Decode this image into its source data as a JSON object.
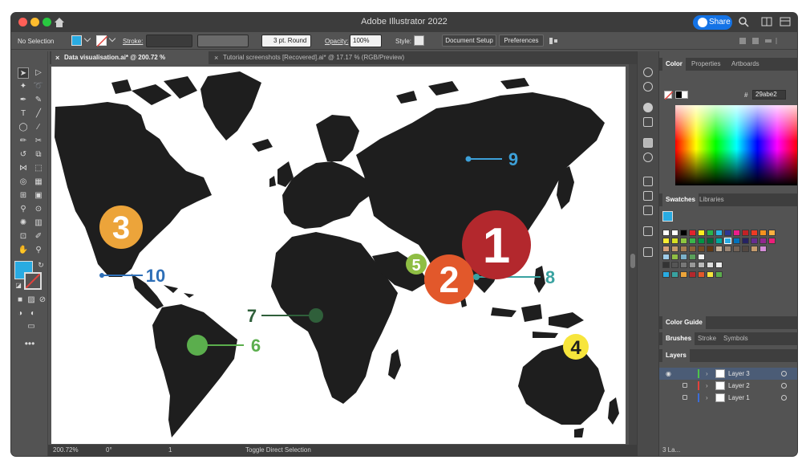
{
  "window": {
    "title": "Adobe Illustrator 2022",
    "share_label": "Share"
  },
  "controlbar": {
    "selection": "No Selection",
    "stroke_label": "Stroke:",
    "brush_value": "3 pt. Round",
    "opacity_label": "Opacity:",
    "opacity_value": "100%",
    "style_label": "Style:",
    "document_setup_label": "Document Setup",
    "preferences_label": "Preferences"
  },
  "tabs": [
    {
      "label": "Data visualisation.ai* @ 200.72 % (RGB/Preview)",
      "close": "×"
    },
    {
      "label": "Tutorial screenshots [Recovered].ai* @ 17.17 % (RGB/Preview)",
      "close": "×"
    }
  ],
  "map": {
    "land_color": "#1e1e1e",
    "markers": [
      {
        "id": "1",
        "label": "1",
        "color": "#b3282d",
        "callout": null
      },
      {
        "id": "2",
        "label": "2",
        "color": "#e2582b",
        "callout": null
      },
      {
        "id": "3",
        "label": "3",
        "color": "#eca43a",
        "callout": null
      },
      {
        "id": "4",
        "label": "4",
        "color": "#f7e53c",
        "callout": null
      },
      {
        "id": "5",
        "label": "5",
        "color": "#8fbe44",
        "callout": null
      },
      {
        "id": "6",
        "label": "6",
        "color": "#5bae4d",
        "callout": "6"
      },
      {
        "id": "7",
        "label": "7",
        "color": "#2f5f3a",
        "callout": "7"
      },
      {
        "id": "8",
        "label": "8",
        "color": "#39a2a0",
        "callout": "8"
      },
      {
        "id": "9",
        "label": "9",
        "color": "#3da0d8",
        "callout": "9"
      },
      {
        "id": "10",
        "label": "10",
        "color": "#2e6fb7",
        "callout": "10"
      }
    ]
  },
  "statusbar": {
    "zoom": "200.72%",
    "rotate": "0°",
    "artboard": "1",
    "status": "Toggle Direct Selection"
  },
  "panels": {
    "color_tabs": [
      "Color",
      "Properties",
      "Artboards"
    ],
    "hex_label": "#",
    "hex_value": "29abe2",
    "swatch_tabs": [
      "Swatches",
      "Libraries"
    ],
    "color_guide_label": "Color Guide",
    "lib_tabs": [
      "Brushes",
      "Stroke",
      "Symbols"
    ],
    "layers_tab": "Layers",
    "layers": [
      {
        "name": "Layer 3",
        "color": "#4fc34a",
        "selected": true,
        "locked": false
      },
      {
        "name": "Layer 2",
        "color": "#e3423c",
        "selected": false,
        "locked": true
      },
      {
        "name": "Layer 1",
        "color": "#3b6cd8",
        "selected": false,
        "locked": true
      }
    ],
    "layers_count": "3 La..."
  },
  "colors": {
    "fill": "#29abe2",
    "ui_bg": "#535353",
    "accent": "#1473e6"
  }
}
